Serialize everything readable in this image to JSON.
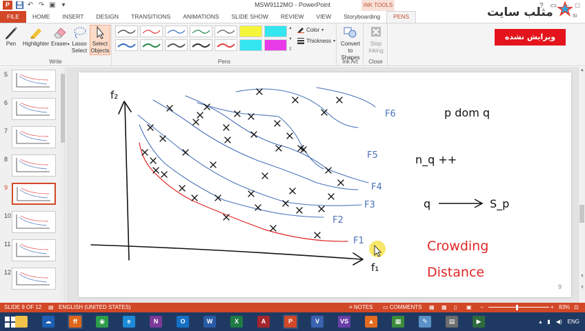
{
  "app": {
    "title": "MSW9112MO - PowerPoint",
    "contextual_group": "INK TOOLS"
  },
  "quick_access": {
    "logo_letter": "P",
    "items": [
      {
        "name": "save-icon",
        "glyph": "💾"
      },
      {
        "name": "undo-icon",
        "glyph": "↶"
      },
      {
        "name": "redo-icon",
        "glyph": "↷"
      },
      {
        "name": "present-icon",
        "glyph": "▣"
      },
      {
        "name": "customize-icon",
        "glyph": "▾"
      }
    ]
  },
  "tabs": [
    "FILE",
    "HOME",
    "INSERT",
    "DESIGN",
    "TRANSITIONS",
    "ANIMATIONS",
    "SLIDE SHOW",
    "REVIEW",
    "VIEW",
    "Storyboarding",
    "PENS"
  ],
  "active_tab": "PENS",
  "ribbon": {
    "write": {
      "label": "Write",
      "buttons": [
        {
          "id": "pen",
          "label": "Pen",
          "icon": "pen-icon"
        },
        {
          "id": "highlighter",
          "label": "Highlighter",
          "icon": "highlighter-icon"
        },
        {
          "id": "eraser",
          "label": "Eraser",
          "icon": "eraser-icon",
          "dropdown": true
        },
        {
          "id": "lasso",
          "label1": "Lasso",
          "label2": "Select",
          "icon": "lasso-icon"
        },
        {
          "id": "select_objects",
          "label1": "Select",
          "label2": "Objects",
          "icon": "cursor-icon",
          "selected": true
        }
      ]
    },
    "pens": {
      "label": "Pens",
      "color_label": "Color",
      "thickness_label": "Thickness",
      "pen_colors": [
        "#333333",
        "#e04040",
        "#3a6fc4",
        "#2a8a4a",
        "#5a5a5a"
      ],
      "highlighter_colors": [
        "#f5f53a",
        "#33e6f0",
        "#e93ae9"
      ]
    },
    "ink_art": {
      "label": "Ink Art",
      "button_line1": "Convert",
      "button_line2": "to Shapes",
      "icon": "shapes-icon"
    },
    "close": {
      "label": "Close",
      "button_line1": "Stop",
      "button_line2": "Inking",
      "icon": "stop-inking-icon",
      "disabled": true
    }
  },
  "branding": {
    "site_name": "مثلب سایت",
    "badge": "ویرایش نشده",
    "si": "Si"
  },
  "thumbnails": [
    {
      "number": "5"
    },
    {
      "number": "6"
    },
    {
      "number": "7"
    },
    {
      "number": "8"
    },
    {
      "number": "9",
      "selected": true
    },
    {
      "number": "10"
    },
    {
      "number": "11"
    },
    {
      "number": "12"
    }
  ],
  "slide": {
    "page_number": "9",
    "ink_text": {
      "y_axis": "f₂",
      "x_axis": "f₁",
      "fronts": [
        "F1",
        "F2",
        "F3",
        "F4",
        "F5",
        "F6"
      ],
      "dom": "p dom q",
      "count": "n_q ++",
      "arrow_text_left": "q",
      "arrow_text_right": "S_p",
      "crowding_line1": "Crowding",
      "crowding_line2": "Distance"
    },
    "colors": {
      "blue_ink": "#4a72b8",
      "red_ink": "#e02626",
      "black_ink": "#111111"
    }
  },
  "status": {
    "slide_info": "SLIDE 9 OF 12",
    "language": "ENGLISH (UNITED STATES)",
    "notes": "NOTES",
    "comments": "COMMENTS",
    "zoom": "83%"
  },
  "taskbar": {
    "items": [
      {
        "name": "file-explorer-icon",
        "label": "",
        "color": "#f0c24a"
      },
      {
        "name": "onedrive-icon",
        "label": "☁",
        "color": "#1e5fb4"
      },
      {
        "name": "firefox-icon",
        "label": "ff",
        "color": "#e0661a",
        "running": true
      },
      {
        "name": "chrome-icon",
        "label": "◉",
        "color": "#2d9d4b"
      },
      {
        "name": "ie-icon",
        "label": "e",
        "color": "#1d8ad8"
      },
      {
        "name": "onenote-icon",
        "label": "N",
        "color": "#7b3a98"
      },
      {
        "name": "outlook-icon",
        "label": "O",
        "color": "#1471c6"
      },
      {
        "name": "word-icon",
        "label": "W",
        "color": "#2a5ba7"
      },
      {
        "name": "excel-icon",
        "label": "X",
        "color": "#1f7a44"
      },
      {
        "name": "access-icon",
        "label": "A",
        "color": "#a4262c"
      },
      {
        "name": "powerpoint-icon",
        "label": "P",
        "color": "#d24726",
        "running": true
      },
      {
        "name": "visio-icon",
        "label": "V",
        "color": "#3b62b0"
      },
      {
        "name": "visual-studio-icon",
        "label": "VS",
        "color": "#6a3fa8"
      },
      {
        "name": "matlab-icon",
        "label": "▲",
        "color": "#e36b1f"
      },
      {
        "name": "image-viewer-icon",
        "label": "▦",
        "color": "#3c8c3c"
      },
      {
        "name": "notepad-icon",
        "label": "✎",
        "color": "#5a91c8"
      },
      {
        "name": "calculator-icon",
        "label": "▤",
        "color": "#6d6d6d"
      },
      {
        "name": "screen-recorder-icon",
        "label": "▶",
        "color": "#2f6a3f"
      }
    ],
    "language": "ENG"
  }
}
